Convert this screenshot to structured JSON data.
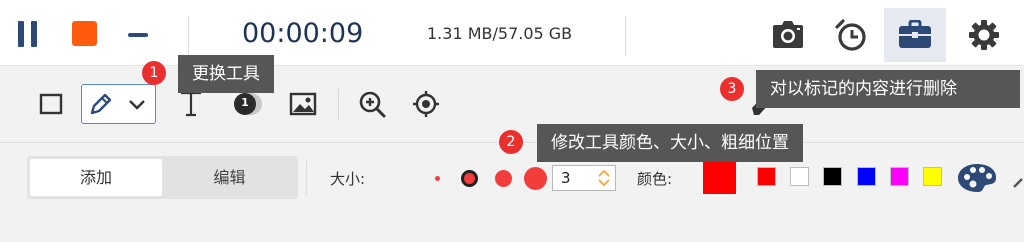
{
  "recorder": {
    "timer": "00:00:09",
    "file_size": "1.31 MB/57.05 GB",
    "stop_color": "#ff5a0f",
    "icons": [
      "pause-icon",
      "stop-icon",
      "minimize-icon",
      "camera-icon",
      "alarm-clock-icon",
      "toolbox-icon",
      "gear-icon"
    ],
    "active_icon": "toolbox-icon"
  },
  "toolbar": {
    "tools": [
      "rectangle-icon",
      "pen-icon",
      "chevron-down-icon",
      "text-icon",
      "step-number-icon",
      "image-icon",
      "zoom-in-icon",
      "crosshair-icon"
    ],
    "step_glyph": "1"
  },
  "options": {
    "tab_add": "添加",
    "tab_edit": "编辑",
    "active_tab": "添加",
    "size_label": "大小:",
    "size_value": "3",
    "color_label": "颜色:",
    "selected_color": "#ff0000",
    "palette": [
      "#ff0000",
      "#ffffff",
      "#000000",
      "#0000ff",
      "#ff00ff",
      "#ffff00"
    ]
  },
  "tooltips": [
    {
      "badge": "1",
      "text": "更换工具"
    },
    {
      "badge": "2",
      "text": "修改工具颜色、大小、粗细位置"
    },
    {
      "badge": "3",
      "text": "对以标记的内容进行删除"
    }
  ]
}
